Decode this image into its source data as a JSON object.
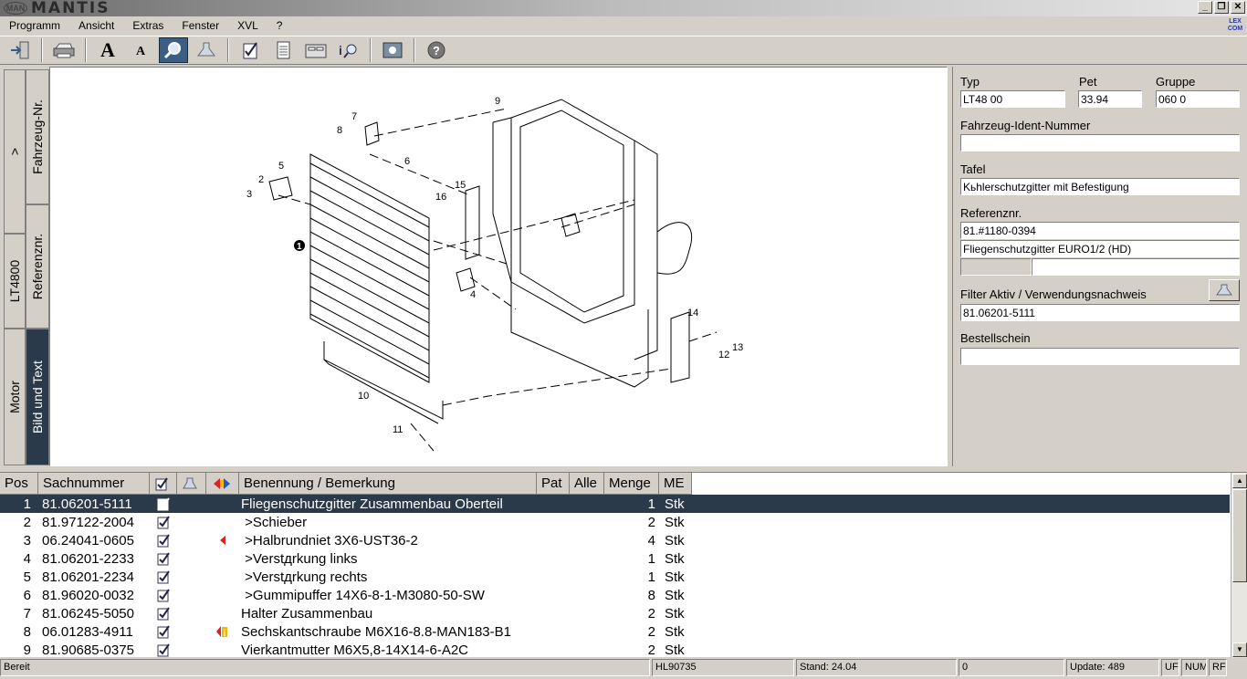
{
  "app": {
    "logo_small": "MAN",
    "logo": "MANTIS",
    "window_controls": [
      "_",
      "❐",
      "✕"
    ],
    "lex_icon": "LEX COM"
  },
  "menu": [
    "Programm",
    "Ansicht",
    "Extras",
    "Fenster",
    "XVL",
    "?"
  ],
  "toolbar": {
    "buttons": [
      "exit-icon",
      "print-icon",
      "font-large-icon",
      "font-small-icon",
      "zoom-icon",
      "filter-icon",
      "checklist-icon",
      "document-icon",
      "cabinet-icon",
      "info-search-icon",
      "image-icon",
      "help-icon"
    ],
    "font_large": "A",
    "font_small": "A",
    "help": "?"
  },
  "side_tabs": {
    "fahrzeug": "Fahrzeug-Nr.",
    "arrow": ">",
    "referenz": "Referenznr.",
    "lt4800": "LT4800",
    "bild": "Bild und Text",
    "motor": "Motor"
  },
  "diagram": {
    "labels": [
      "1",
      "2",
      "3",
      "4",
      "5",
      "6",
      "7",
      "8",
      "9",
      "10",
      "11",
      "12",
      "13",
      "14",
      "15",
      "16"
    ]
  },
  "details": {
    "typ_label": "Typ",
    "typ_value": "LT48 00",
    "pet_label": "Pet",
    "pet_value": "33.94",
    "gruppe_label": "Gruppe",
    "gruppe_value": "060 0",
    "ident_label": "Fahrzeug-Ident-Nummer",
    "ident_value": "",
    "tafel_label": "Tafel",
    "tafel_value": "Kьhlerschutzgitter mit Befestigung",
    "ref_label": "Referenznr.",
    "ref_value": "81.#1180-0394",
    "ref_desc": "Fliegenschutzgitter EURO1/2 (HD)",
    "filter_label": "Filter Aktiv / Verwendungsnachweis",
    "filter_value": "81.06201-5111",
    "bestell_label": "Bestellschein",
    "bestell_value": ""
  },
  "table": {
    "headers": {
      "pos": "Pos",
      "sach": "Sachnummer",
      "benennung": "Benennung / Bemerkung",
      "pat": "Pat",
      "alle": "Alle",
      "menge": "Menge",
      "me": "ME"
    },
    "rows": [
      {
        "pos": "1",
        "sach": "81.06201-5111",
        "flag": "",
        "benennung": "Fliegenschutzgitter Zusammenbau Oberteil",
        "menge": "1",
        "me": "Stk"
      },
      {
        "pos": "2",
        "sach": "81.97122-2004",
        "flag": "",
        "benennung": " >Schieber",
        "menge": "2",
        "me": "Stk"
      },
      {
        "pos": "3",
        "sach": "06.24041-0605",
        "flag": "arrow",
        "benennung": " >Halbrundniet 3X6-UST36-2",
        "menge": "4",
        "me": "Stk"
      },
      {
        "pos": "4",
        "sach": "81.06201-2233",
        "flag": "",
        "benennung": " >Verstдrkung links",
        "menge": "1",
        "me": "Stk"
      },
      {
        "pos": "5",
        "sach": "81.06201-2234",
        "flag": "",
        "benennung": " >Verstдrkung rechts",
        "menge": "1",
        "me": "Stk"
      },
      {
        "pos": "6",
        "sach": "81.96020-0032",
        "flag": "",
        "benennung": " >Gummipuffer 14X6-8-1-M3080-50-SW",
        "menge": "8",
        "me": "Stk"
      },
      {
        "pos": "7",
        "sach": "81.06245-5050",
        "flag": "",
        "benennung": "Halter Zusammenbau",
        "menge": "2",
        "me": "Stk"
      },
      {
        "pos": "8",
        "sach": "06.01283-4911",
        "flag": "info",
        "benennung": "Sechskantschraube M6X16-8.8-MAN183-B1",
        "menge": "2",
        "me": "Stk"
      },
      {
        "pos": "9",
        "sach": "81.90685-0375",
        "flag": "",
        "benennung": "Vierkantmutter M6X5,8-14X14-6-A2C",
        "menge": "2",
        "me": "Stk"
      }
    ]
  },
  "status": {
    "ready": "Bereit",
    "hl": "HL90735",
    "stand": "Stand: 24.04",
    "zero": "0",
    "update": "Update: 489",
    "uf": "UF",
    "num": "NUM",
    "rf": "RF"
  }
}
